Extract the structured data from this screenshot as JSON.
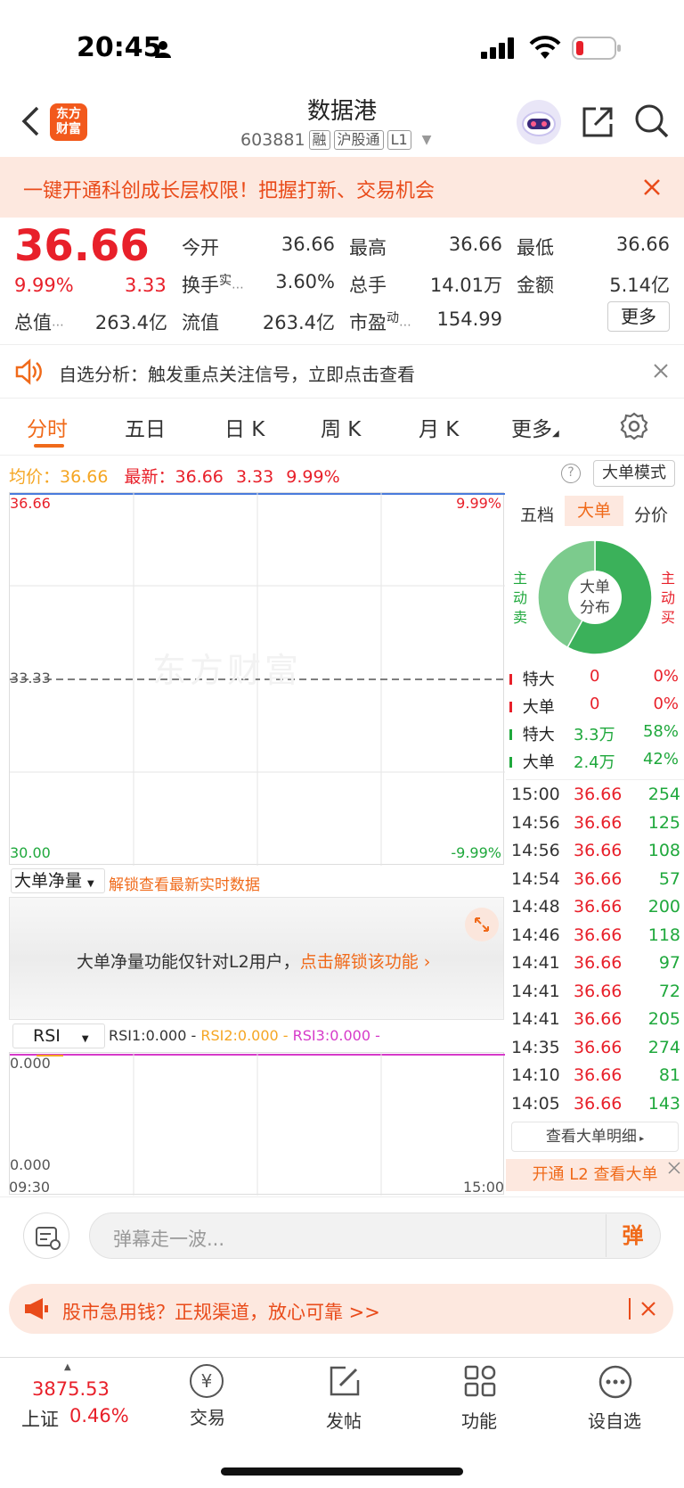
{
  "status": {
    "time": "20:45"
  },
  "header": {
    "title": "数据港",
    "code": "603881",
    "tags": [
      "融",
      "沪股通",
      "L1"
    ],
    "logo_text": "东方财富"
  },
  "promo_banner": {
    "text": "一键开通科创成长层权限！把握打新、交易机会"
  },
  "quote": {
    "price": "36.66",
    "change_pct": "9.99%",
    "change": "3.33",
    "open_label": "今开",
    "open": "36.66",
    "high_label": "最高",
    "high": "36.66",
    "low_label": "最低",
    "low": "36.66",
    "turnover_label": "换手",
    "turnover_sup": "实",
    "turnover": "3.60%",
    "volume_label": "总手",
    "volume": "14.01万",
    "amount_label": "金额",
    "amount": "5.14亿",
    "mktcap_label": "总值",
    "mktcap": "263.4亿",
    "float_label": "流值",
    "float": "263.4亿",
    "pe_label": "市盈",
    "pe_sup": "动",
    "pe": "154.99",
    "more_button": "更多"
  },
  "notice": {
    "text": "自选分析：触发重点关注信号，立即点击查看"
  },
  "tabs": [
    "分时",
    "五日",
    "日 K",
    "周 K",
    "月 K",
    "更多"
  ],
  "price_line": {
    "avg_label": "均价：",
    "avg": "36.66",
    "latest_label": "最新：",
    "latest": "36.66",
    "change": "3.33",
    "pct": "9.99%",
    "mode_button": "大单模式"
  },
  "chart": {
    "top_left": "36.66",
    "top_right": "9.99%",
    "mid_left": "33.33",
    "bottom_left": "30.00",
    "bottom_right": "-9.99%",
    "watermark": "东方财富",
    "time_start": "09:30",
    "time_end": "15:00"
  },
  "net_panel": {
    "selector": "大单净量",
    "unlock_hint": "解锁查看最新实时数据",
    "msg_prefix": "大单净量功能仅针对L2用户，",
    "msg_link": "点击解锁该功能"
  },
  "rsi": {
    "selector": "RSI",
    "rsi1": "RSI1:0.000 -",
    "rsi2": "RSI2:0.000 -",
    "rsi3": "RSI3:0.000 -",
    "top": "0.000",
    "bottom": "0.000"
  },
  "side": {
    "tabs": [
      "五档",
      "大单",
      "分价"
    ],
    "donut_center": "大单分布",
    "left_label": "主动卖",
    "right_label": "主动买",
    "donut": {
      "buy_pct": 58,
      "sell_pct": 42
    },
    "dist": [
      {
        "label": "特大",
        "val": "0",
        "pct": "0%"
      },
      {
        "label": "大单",
        "val": "0",
        "pct": "0%"
      },
      {
        "label": "特大",
        "val": "3.3万",
        "pct": "58%"
      },
      {
        "label": "大单",
        "val": "2.4万",
        "pct": "42%"
      }
    ],
    "trades": [
      {
        "t": "15:00",
        "p": "36.66",
        "v": "254"
      },
      {
        "t": "14:56",
        "p": "36.66",
        "v": "125"
      },
      {
        "t": "14:56",
        "p": "36.66",
        "v": "108"
      },
      {
        "t": "14:54",
        "p": "36.66",
        "v": "57"
      },
      {
        "t": "14:48",
        "p": "36.66",
        "v": "200"
      },
      {
        "t": "14:46",
        "p": "36.66",
        "v": "118"
      },
      {
        "t": "14:41",
        "p": "36.66",
        "v": "97"
      },
      {
        "t": "14:41",
        "p": "36.66",
        "v": "72"
      },
      {
        "t": "14:41",
        "p": "36.66",
        "v": "205"
      },
      {
        "t": "14:35",
        "p": "36.66",
        "v": "274"
      },
      {
        "t": "14:10",
        "p": "36.66",
        "v": "81"
      },
      {
        "t": "14:05",
        "p": "36.66",
        "v": "143"
      }
    ],
    "detail_button": "查看大单明细",
    "l2_button": "开通 L2 查看大单"
  },
  "danmu": {
    "placeholder": "弹幕走一波...",
    "send": "弹"
  },
  "ad": {
    "text": "股市急用钱？正规渠道，放心可靠 >>"
  },
  "bottom_nav": {
    "index_value": "3875.53",
    "index_name": "上证",
    "index_pct": "0.46%",
    "items": [
      "交易",
      "发帖",
      "功能",
      "设自选"
    ]
  },
  "colors": {
    "up": "#e8202a",
    "down": "#1fa83c",
    "accent": "#f06a1a"
  }
}
